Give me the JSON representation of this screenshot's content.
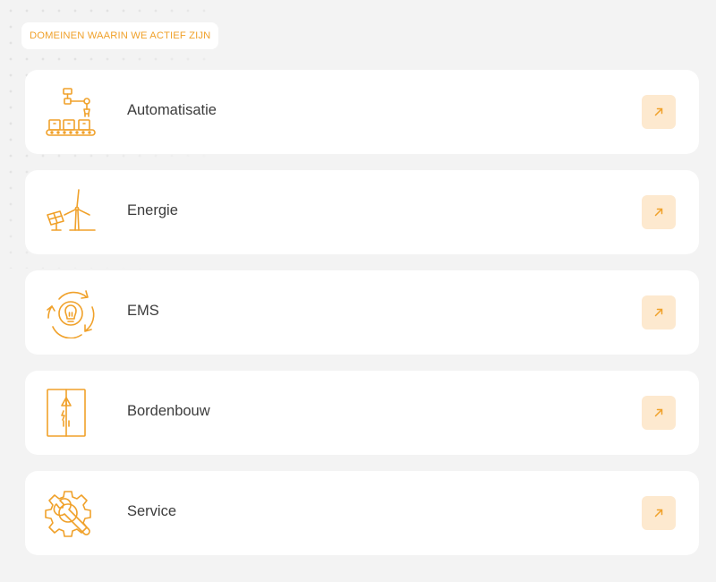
{
  "section_label": "DOMEINEN WAARIN WE ACTIEF ZIJN",
  "accent_color": "#f0a12a",
  "domains": [
    {
      "label": "Automatisatie",
      "icon": "robot-arm-conveyor-icon"
    },
    {
      "label": "Energie",
      "icon": "solar-wind-turbine-icon"
    },
    {
      "label": "EMS",
      "icon": "lightbulb-cycle-icon"
    },
    {
      "label": "Bordenbouw",
      "icon": "electrical-cabinet-icon"
    },
    {
      "label": "Service",
      "icon": "gear-wrench-icon"
    }
  ]
}
